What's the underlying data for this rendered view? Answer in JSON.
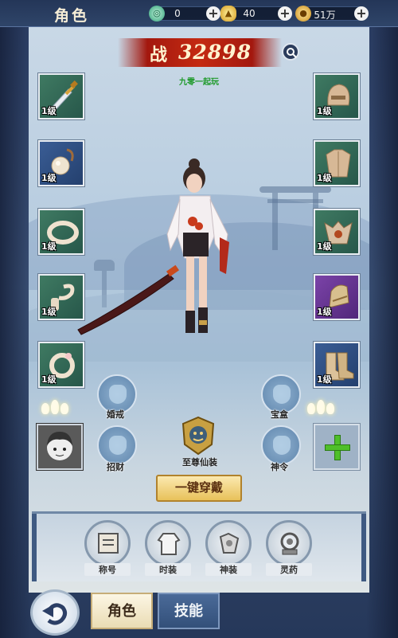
{
  "header": {
    "title": "角色"
  },
  "currencies": [
    {
      "name": "jade",
      "icon": "jade-icon",
      "value": "0"
    },
    {
      "name": "gold-ingot",
      "icon": "gold-ingot-icon",
      "value": "40"
    },
    {
      "name": "coin",
      "icon": "coin-icon",
      "value": "51万"
    }
  ],
  "power": {
    "label": "战",
    "value": "32898"
  },
  "server_text": "九零一起玩",
  "equipment": {
    "left": [
      {
        "name": "weapon-sword",
        "level": "1级",
        "rarity": "green"
      },
      {
        "name": "necklace",
        "level": "1级",
        "rarity": "blue"
      },
      {
        "name": "bracelet",
        "level": "1级",
        "rarity": "green"
      },
      {
        "name": "waist-ornament",
        "level": "1级",
        "rarity": "green"
      },
      {
        "name": "ring",
        "level": "1级",
        "rarity": "green"
      }
    ],
    "right": [
      {
        "name": "helmet",
        "level": "1级",
        "rarity": "green"
      },
      {
        "name": "armor",
        "level": "1级",
        "rarity": "green"
      },
      {
        "name": "shoulder",
        "level": "1级",
        "rarity": "green"
      },
      {
        "name": "gloves",
        "level": "1级",
        "rarity": "purple"
      },
      {
        "name": "boots",
        "level": "1级",
        "rarity": "blue"
      }
    ]
  },
  "special_slots": {
    "marriage_ring": "婚戒",
    "recruit": "招财",
    "treasure_box": "宝盒",
    "divine_order": "神令",
    "supreme_outfit": "至尊仙装"
  },
  "equip_all_label": "一键穿戴",
  "functions": [
    {
      "label": "称号",
      "icon": "title-scroll-icon"
    },
    {
      "label": "时装",
      "icon": "fashion-robe-icon"
    },
    {
      "label": "神装",
      "icon": "divine-gear-icon"
    },
    {
      "label": "灵药",
      "icon": "elixir-icon"
    }
  ],
  "tabs": {
    "active": "角色",
    "inactive": "技能"
  }
}
